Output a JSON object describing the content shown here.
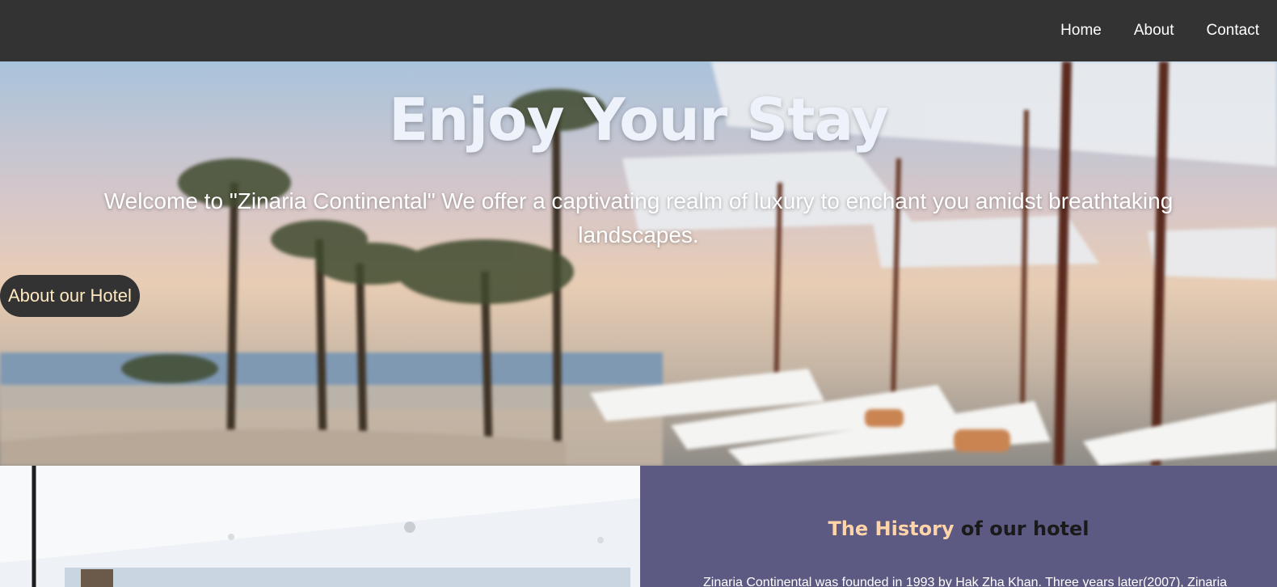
{
  "nav": {
    "links": [
      "Home",
      "About",
      "Contact"
    ]
  },
  "hero": {
    "title": "Enjoy Your Stay",
    "text": "Welcome to \"Zinaria Continental\" We offer a captivating realm of luxury to enchant you amidst breathtaking landscapes.",
    "button_label": "About our Hotel"
  },
  "history": {
    "title_part1": "The History",
    "title_part2": " of our hotel",
    "body": "Zinaria Continental was founded in 1993 by Hak Zha Khan. Three years later(2007), Zinaria"
  },
  "colors": {
    "nav_bg": "#333333",
    "history_bg": "#5c5a82",
    "title_accent": "#ffd4a8",
    "button_text": "#ffe9c2"
  }
}
